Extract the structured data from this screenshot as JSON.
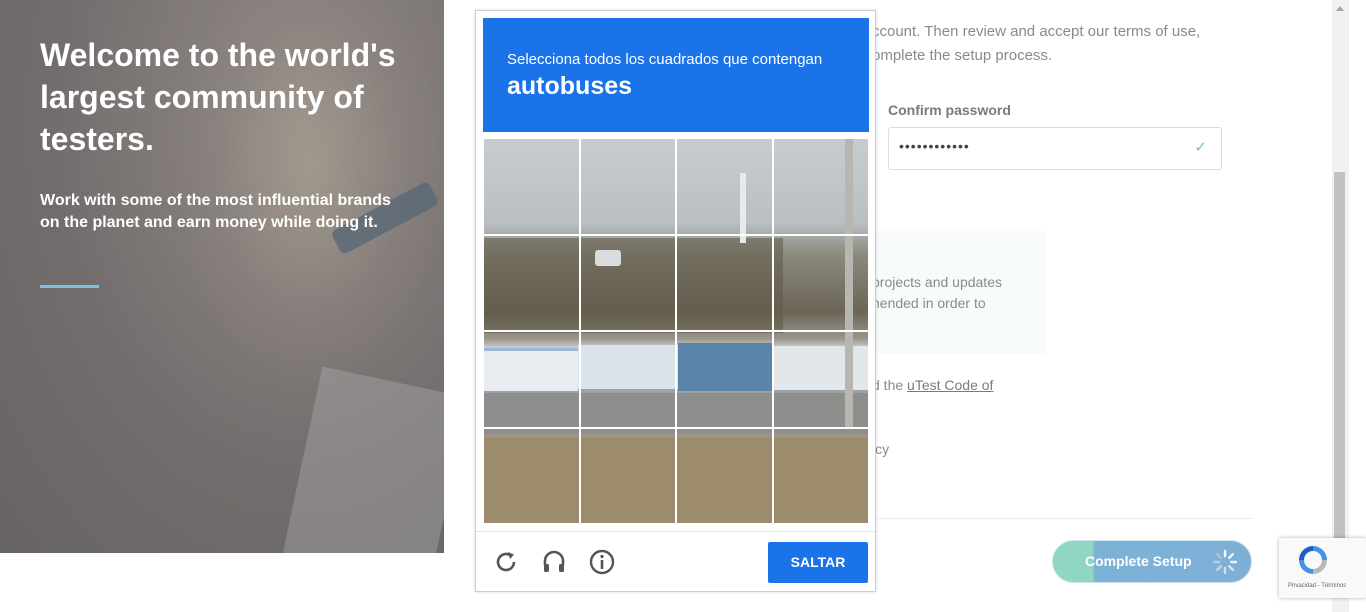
{
  "hero": {
    "title": "Welcome to the world's largest community of testers.",
    "subtitle": "Work with some of the most influential brands on the planet and earn money while doing it."
  },
  "form": {
    "intro_line1": "ccount. Then review and accept our terms of use,",
    "intro_line2": "omplete the setup process.",
    "confirm_password_label": "Confirm password",
    "confirm_password_value": "••••••••••••",
    "info_line1": "projects and updates",
    "info_line2": "nended in order to",
    "code_prefix": "d the ",
    "code_link": "uTest Code of",
    "policy_fragment": "icy",
    "complete_button": "Complete Setup"
  },
  "captcha": {
    "instruction": "Selecciona todos los cuadrados que contengan",
    "target": "autobuses",
    "skip_button": "SALTAR",
    "icons": [
      "reload-icon",
      "audio-icon",
      "info-icon"
    ]
  },
  "recaptcha_badge": {
    "legal": "Privacidad - Términos"
  },
  "colors": {
    "captcha_blue": "#1a73e8",
    "hero_accent": "#79c3e0",
    "button_start": "#8fd6c3",
    "button_end": "#7eb0d6"
  }
}
